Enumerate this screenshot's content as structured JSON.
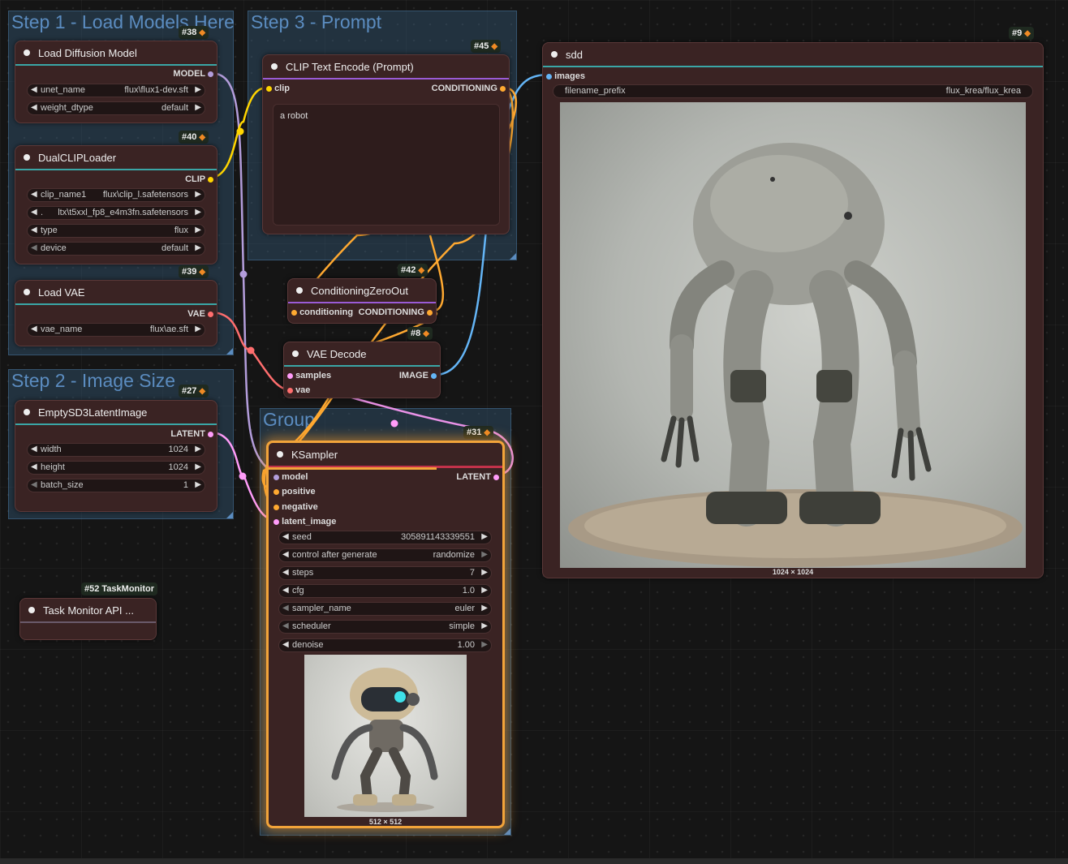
{
  "groups": {
    "step1": "Step 1 - Load Models Here",
    "step3": "Step 3 - Prompt",
    "step2": "Step 2 - Image Size",
    "group": "Group"
  },
  "nodes": {
    "load_diffusion": {
      "badge": "#38",
      "title": "Load Diffusion Model",
      "output": "MODEL",
      "widgets": [
        {
          "label": "unet_name",
          "value": "flux\\flux1-dev.sft"
        },
        {
          "label": "weight_dtype",
          "value": "default"
        }
      ]
    },
    "dual_clip": {
      "badge": "#40",
      "title": "DualCLIPLoader",
      "output": "CLIP",
      "widgets": [
        {
          "label": "clip_name1",
          "value": "flux\\clip_l.safetensors"
        },
        {
          "label": ".",
          "value": "ltx\\t5xxl_fp8_e4m3fn.safetensors"
        },
        {
          "label": "type",
          "value": "flux"
        },
        {
          "label": "device",
          "value": "default"
        }
      ]
    },
    "load_vae": {
      "badge": "#39",
      "title": "Load VAE",
      "output": "VAE",
      "widgets": [
        {
          "label": "vae_name",
          "value": "flux\\ae.sft"
        }
      ]
    },
    "empty_latent": {
      "badge": "#27",
      "title": "EmptySD3LatentImage",
      "output": "LATENT",
      "widgets": [
        {
          "label": "width",
          "value": "1024"
        },
        {
          "label": "height",
          "value": "1024"
        },
        {
          "label": "batch_size",
          "value": "1"
        }
      ]
    },
    "clip_text": {
      "badge": "#45",
      "title": "CLIP Text Encode (Prompt)",
      "input": "clip",
      "output": "CONDITIONING",
      "text": "a robot"
    },
    "cond_zero": {
      "badge": "#42",
      "title": "ConditioningZeroOut",
      "input": "conditioning",
      "output": "CONDITIONING"
    },
    "vae_decode": {
      "badge": "#8",
      "title": "VAE Decode",
      "inputs": [
        "samples",
        "vae"
      ],
      "output": "IMAGE"
    },
    "ksampler": {
      "badge": "#31",
      "title": "KSampler",
      "inputs": [
        "model",
        "positive",
        "negative",
        "latent_image"
      ],
      "output": "LATENT",
      "widgets": [
        {
          "label": "seed",
          "value": "305891143339551"
        },
        {
          "label": "control after generate",
          "value": "randomize"
        },
        {
          "label": "steps",
          "value": "7"
        },
        {
          "label": "cfg",
          "value": "1.0"
        },
        {
          "label": "sampler_name",
          "value": "euler"
        },
        {
          "label": "scheduler",
          "value": "simple"
        },
        {
          "label": "denoise",
          "value": "1.00"
        }
      ],
      "preview_size": "512 × 512"
    },
    "save": {
      "badge": "#9",
      "title": "sdd",
      "input": "images",
      "widget": {
        "label": "filename_prefix",
        "value": "flux_krea/flux_krea"
      },
      "preview_size": "1024 × 1024"
    },
    "task_monitor": {
      "badge": "#52 TaskMonitor",
      "title": "Task Monitor API ..."
    }
  },
  "colors": {
    "model": "#b39ddb",
    "clip": "#ffd500",
    "vae": "#ff6e6e",
    "conditioning": "#ffa931",
    "latent": "#ff9cf9",
    "image": "#64b5f6",
    "selected": "#f2a43a"
  }
}
